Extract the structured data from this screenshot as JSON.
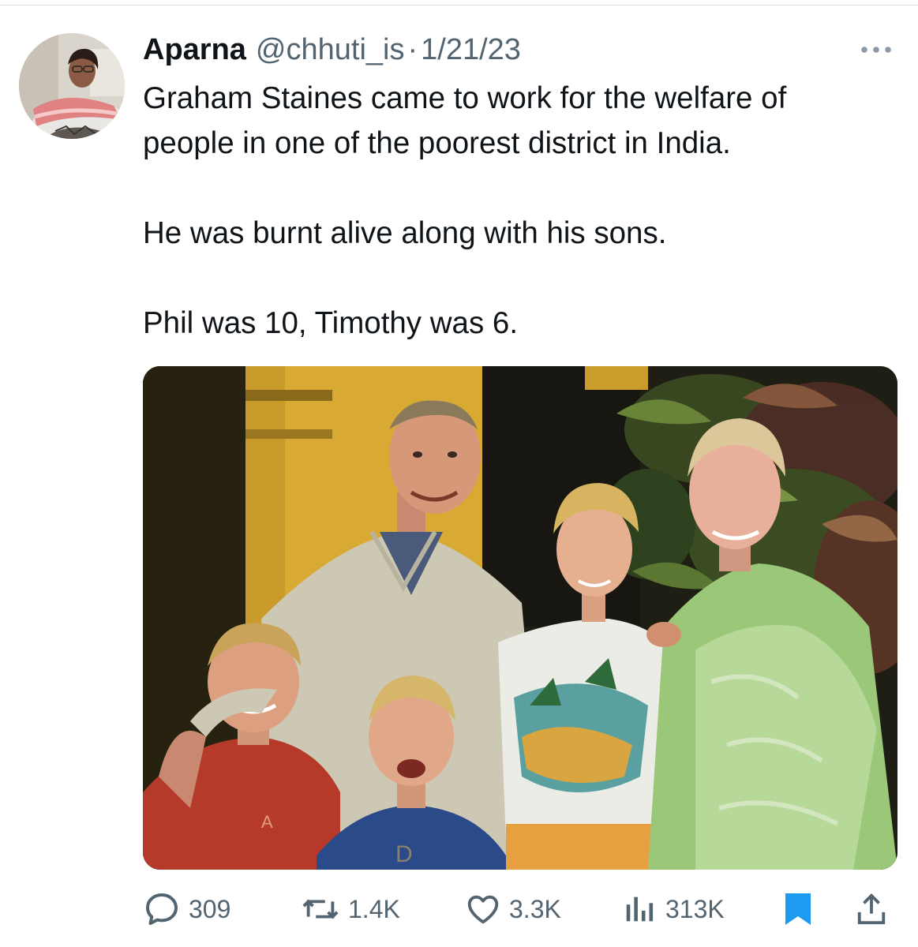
{
  "tweet": {
    "author": {
      "display_name": "Aparna",
      "handle": "@chhuti_is",
      "separator": "·",
      "date": "1/21/23"
    },
    "text": {
      "paragraph_1_line_1": "Graham Staines came to work for the welfare of",
      "paragraph_1_line_2": "people in one of  the poorest district in India.",
      "paragraph_2": "He was burnt alive along with his sons.",
      "paragraph_3": "Phil was 10, Timothy was 6."
    },
    "media": {
      "kind": "photo",
      "icon": "family-photo"
    },
    "actions": {
      "replies": {
        "icon": "reply-icon",
        "count": "309"
      },
      "retweets": {
        "icon": "retweet-icon",
        "count": "1.4K"
      },
      "likes": {
        "icon": "heart-icon",
        "count": "3.3K"
      },
      "views": {
        "icon": "views-icon",
        "count": "313K"
      },
      "bookmark": {
        "icon": "bookmark-icon",
        "active": true
      },
      "share": {
        "icon": "share-icon"
      }
    }
  },
  "colors": {
    "text_primary": "#0f1419",
    "text_secondary": "#536471",
    "accent_blue": "#1d9bf0",
    "divider": "#d9dde1"
  }
}
